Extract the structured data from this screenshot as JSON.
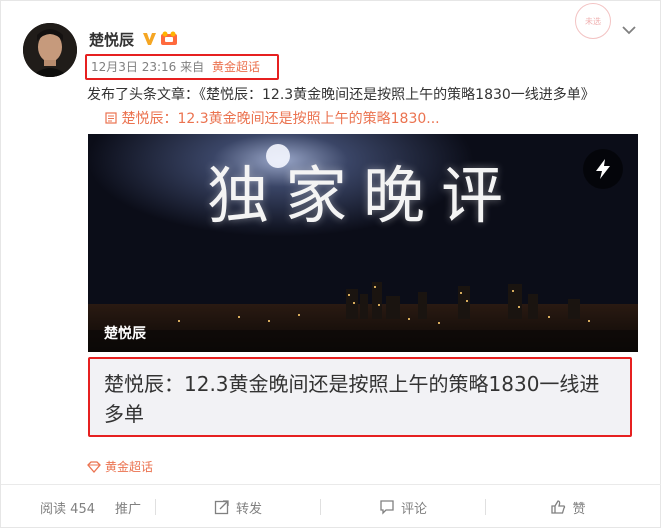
{
  "user": {
    "name": "楚悦辰"
  },
  "post": {
    "timestamp": "12月3日 23:16",
    "from_label": "来自",
    "source": "黄金超话",
    "text": "发布了头条文章：《楚悦辰：12.3黄金晚间还是按照上午的策略1830一线进多单》",
    "link_text": "楚悦辰：12.3黄金晚间还是按照上午的策略1830..."
  },
  "hero": {
    "title": "独家晚评",
    "author_tag": "楚悦辰"
  },
  "article": {
    "title": "楚悦辰：12.3黄金晚间还是按照上午的策略1830一线进多单"
  },
  "topic": {
    "label": "黄金超话"
  },
  "footer": {
    "reads": "阅读 454",
    "promote": "推广",
    "forward": "转发",
    "comment": "评论",
    "like": "赞"
  },
  "stamp": {
    "text": "未选"
  },
  "colors": {
    "accent": "#eb7350",
    "highlight_box": "#e62020"
  }
}
